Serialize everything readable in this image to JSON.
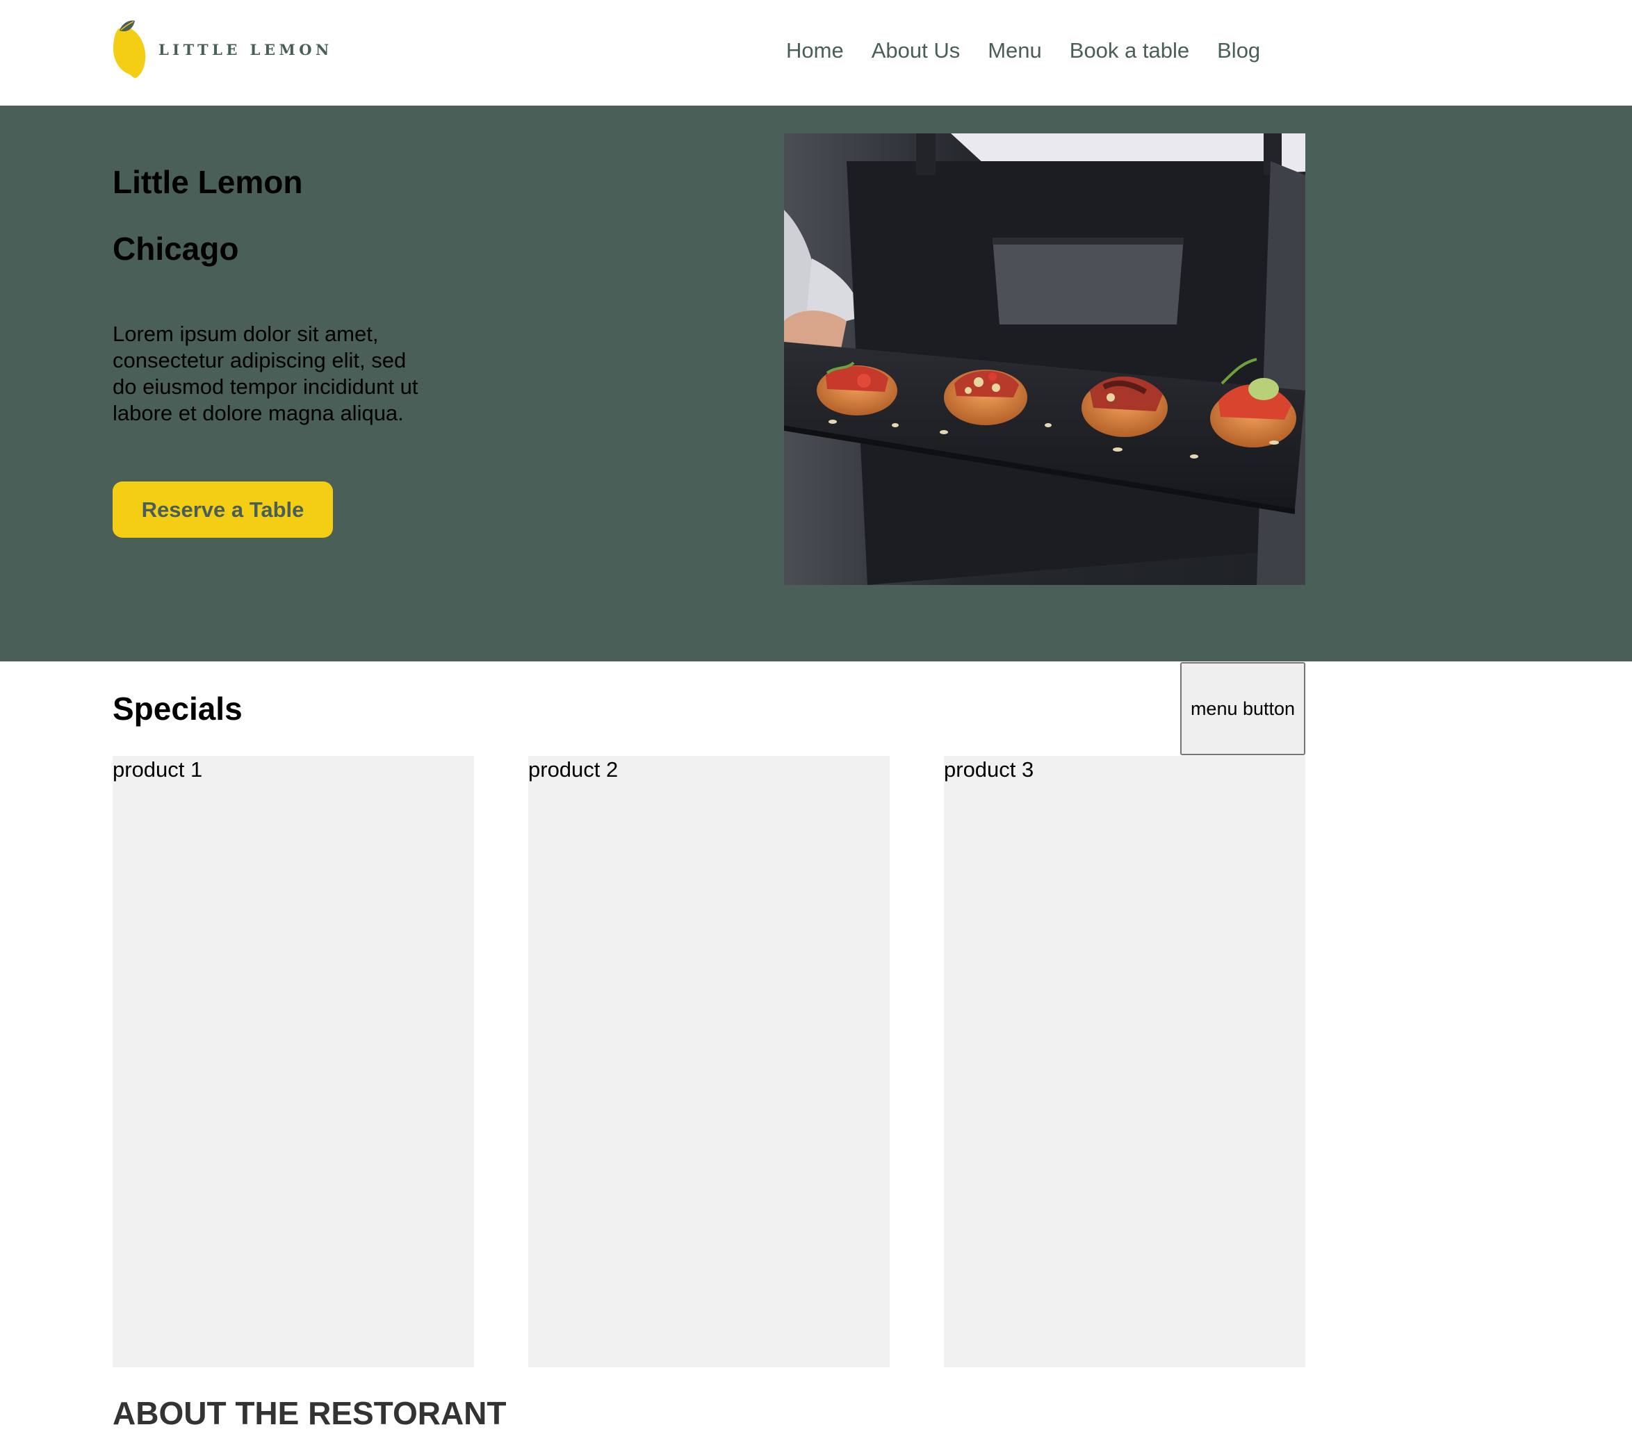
{
  "header": {
    "logo_text": "LITTLE LEMON",
    "nav": {
      "home": "Home",
      "about": "About Us",
      "menu": "Menu",
      "book": "Book a table",
      "blog": "Blog"
    }
  },
  "hero": {
    "title": "Little Lemon",
    "subtitle": "Chicago",
    "description": "Lorem ipsum dolor sit amet, consectetur adipiscing elit, sed do eiusmod tempor incididunt ut labore et dolore magna aliqua.",
    "reserve_label": "Reserve a Table"
  },
  "specials": {
    "title": "Specials",
    "menu_button_label": "menu button",
    "products": [
      {
        "label": "product 1"
      },
      {
        "label": "product 2"
      },
      {
        "label": "product 3"
      }
    ]
  },
  "about": {
    "title": "ABOUT THE RESTORANT"
  },
  "colors": {
    "primary_green": "#495e57",
    "hero_background": "#4a5f57",
    "accent_yellow": "#f4ce14",
    "card_background": "#f1f1f1"
  },
  "icons": {
    "logo": "lemon-icon"
  }
}
